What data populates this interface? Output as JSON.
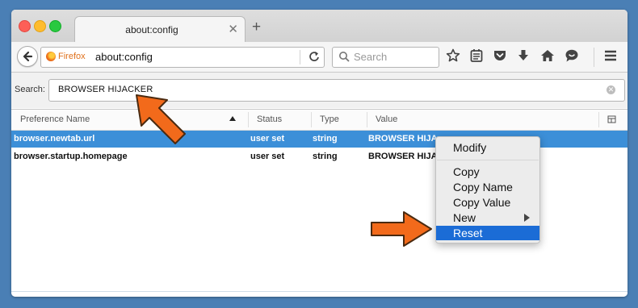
{
  "tab": {
    "title": "about:config",
    "close": "✕",
    "new_tab": "+"
  },
  "navbar": {
    "identity_label": "Firefox",
    "url": "about:config",
    "search_placeholder": "Search"
  },
  "config": {
    "search_label": "Search:",
    "search_value": "BROWSER HIJACKER",
    "columns": [
      "Preference Name",
      "Status",
      "Type",
      "Value"
    ],
    "rows": [
      {
        "name": "browser.newtab.url",
        "status": "user set",
        "type": "string",
        "value": "BROWSER HIJA"
      },
      {
        "name": "browser.startup.homepage",
        "status": "user set",
        "type": "string",
        "value": "BROWSER HIJA"
      }
    ]
  },
  "context_menu": {
    "items": [
      "Modify",
      "Copy",
      "Copy Name",
      "Copy Value",
      "New",
      "Reset"
    ],
    "highlighted": "Reset"
  },
  "colors": {
    "selection": "#3c8fd8",
    "menu_highlight": "#1b6cd6",
    "annotation_arrow": "#f26a1b"
  },
  "icons": [
    "back-arrow-icon",
    "firefox-icon",
    "reload-icon",
    "search-icon",
    "bookmark-star-icon",
    "reading-list-icon",
    "pocket-icon",
    "download-icon",
    "home-icon",
    "chat-icon",
    "menu-icon",
    "column-picker-icon",
    "clear-search-icon",
    "submenu-arrow-icon"
  ]
}
